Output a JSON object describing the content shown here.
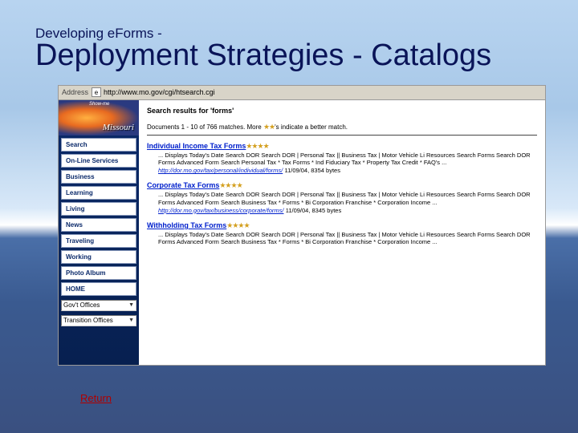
{
  "title": {
    "kicker": "Developing eForms -",
    "main": "Deployment Strategies - Catalogs"
  },
  "addressBar": {
    "label": "Address",
    "url": "http://www.mo.gov/cgi/htsearch.cgi"
  },
  "logo": {
    "caption": "Show-me",
    "name": "Missouri"
  },
  "nav": {
    "items": [
      "Search",
      "On-Line Services",
      "Business",
      "Learning",
      "Living",
      "News",
      "Traveling",
      "Working",
      "Photo Album",
      "HOME"
    ],
    "selects": [
      "Gov't Offices",
      "Transition Offices"
    ]
  },
  "search": {
    "header": "Search results for 'forms'",
    "count_prefix": "Documents 1 - 10 of 766 matches. More ",
    "count_suffix": "'s indicate a better match.",
    "stars": "★★"
  },
  "results": [
    {
      "title": "Individual Income Tax Forms",
      "stars": "★★★★",
      "desc": "... Displays Today's Date Search DOR Search DOR | Personal Tax || Business Tax | Motor Vehicle Li Resources Search Forms Search DOR Forms Advanced Form Search Personal Tax * Tax Forms * Ind Fiduciary Tax * Property Tax Credit * FAQ's ...",
      "url": "http://dor.mo.gov/tax/personal/individual/forms/",
      "meta": "11/09/04, 8354 bytes"
    },
    {
      "title": "Corporate Tax Forms",
      "stars": "★★★★",
      "desc": "... Displays Today's Date Search DOR Search DOR | Personal Tax || Business Tax | Motor Vehicle Li Resources Search Forms Search DOR Forms Advanced Form Search Business Tax * Forms * Bi Corporation Franchise * Corporation Income ...",
      "url": "http://dor.mo.gov/tax/business/corporate/forms/",
      "meta": "11/09/04, 8345 bytes"
    },
    {
      "title": "Withholding Tax Forms",
      "stars": "★★★★",
      "desc": "... Displays Today's Date Search DOR Search DOR | Personal Tax || Business Tax | Motor Vehicle Li Resources Search Forms Search DOR Forms Advanced Form Search Business Tax * Forms * Bi Corporation Franchise * Corporation Income ...",
      "url": "",
      "meta": ""
    }
  ],
  "return_label": "Return"
}
